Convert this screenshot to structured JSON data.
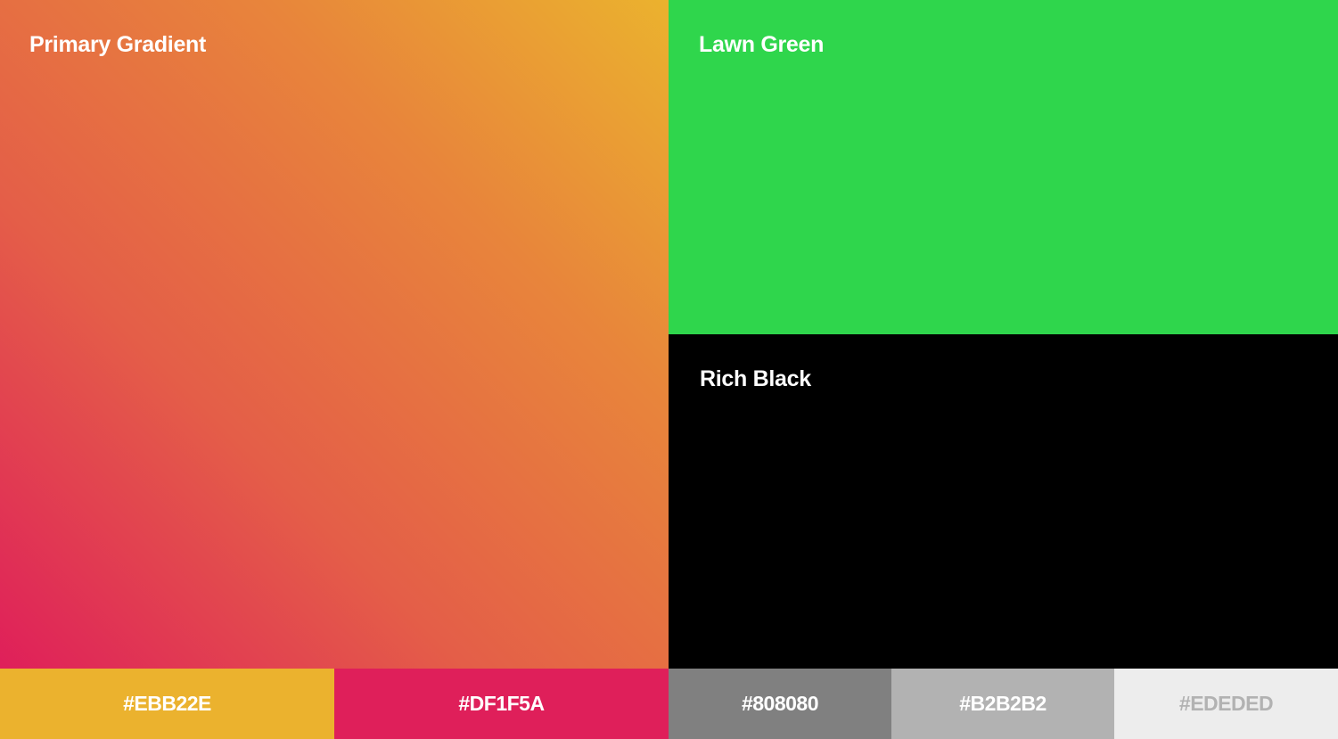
{
  "panels": {
    "gradient": {
      "label": "Primary Gradient",
      "colors": [
        "#DF1F5A",
        "#EBB22E"
      ]
    },
    "green": {
      "label": "Lawn Green",
      "color": "#2FD64C"
    },
    "black": {
      "label": "Rich Black",
      "color": "#000000"
    }
  },
  "swatches": [
    {
      "label": "#EBB22E",
      "color": "#EBB22E",
      "text_color": "#FFFFFF"
    },
    {
      "label": "#DF1F5A",
      "color": "#DF1F5A",
      "text_color": "#FFFFFF"
    },
    {
      "label": "#808080",
      "color": "#808080",
      "text_color": "#FFFFFF"
    },
    {
      "label": "#B2B2B2",
      "color": "#B2B2B2",
      "text_color": "#FFFFFF"
    },
    {
      "label": "#EDEDED",
      "color": "#EDEDED",
      "text_color": "#B2B2B2"
    }
  ]
}
